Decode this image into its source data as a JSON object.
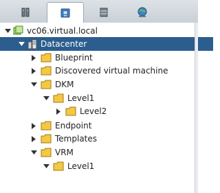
{
  "tabs": [
    {
      "icon": "hosts-clusters-icon",
      "active": false
    },
    {
      "icon": "vms-templates-icon",
      "active": true
    },
    {
      "icon": "storage-icon",
      "active": false
    },
    {
      "icon": "networking-icon",
      "active": false
    }
  ],
  "tree": {
    "root": {
      "label": "vc06.virtual.local",
      "expanded": true
    },
    "items": [
      {
        "label": "Datacenter",
        "expanded": true,
        "selected": true
      },
      {
        "label": "Blueprint",
        "expanded": false
      },
      {
        "label": "Discovered virtual machine",
        "expanded": false
      },
      {
        "label": "DKM",
        "expanded": true
      },
      {
        "label": "Level1",
        "expanded": true
      },
      {
        "label": "Level2",
        "expanded": false
      },
      {
        "label": "Endpoint",
        "expanded": false
      },
      {
        "label": "Templates",
        "expanded": false
      },
      {
        "label": "VRM",
        "expanded": true
      },
      {
        "label": "Level1",
        "expanded": false
      }
    ]
  },
  "colors": {
    "selection": "#2b5e8e",
    "folder": "#f5c842",
    "accent_green": "#4aa832"
  }
}
